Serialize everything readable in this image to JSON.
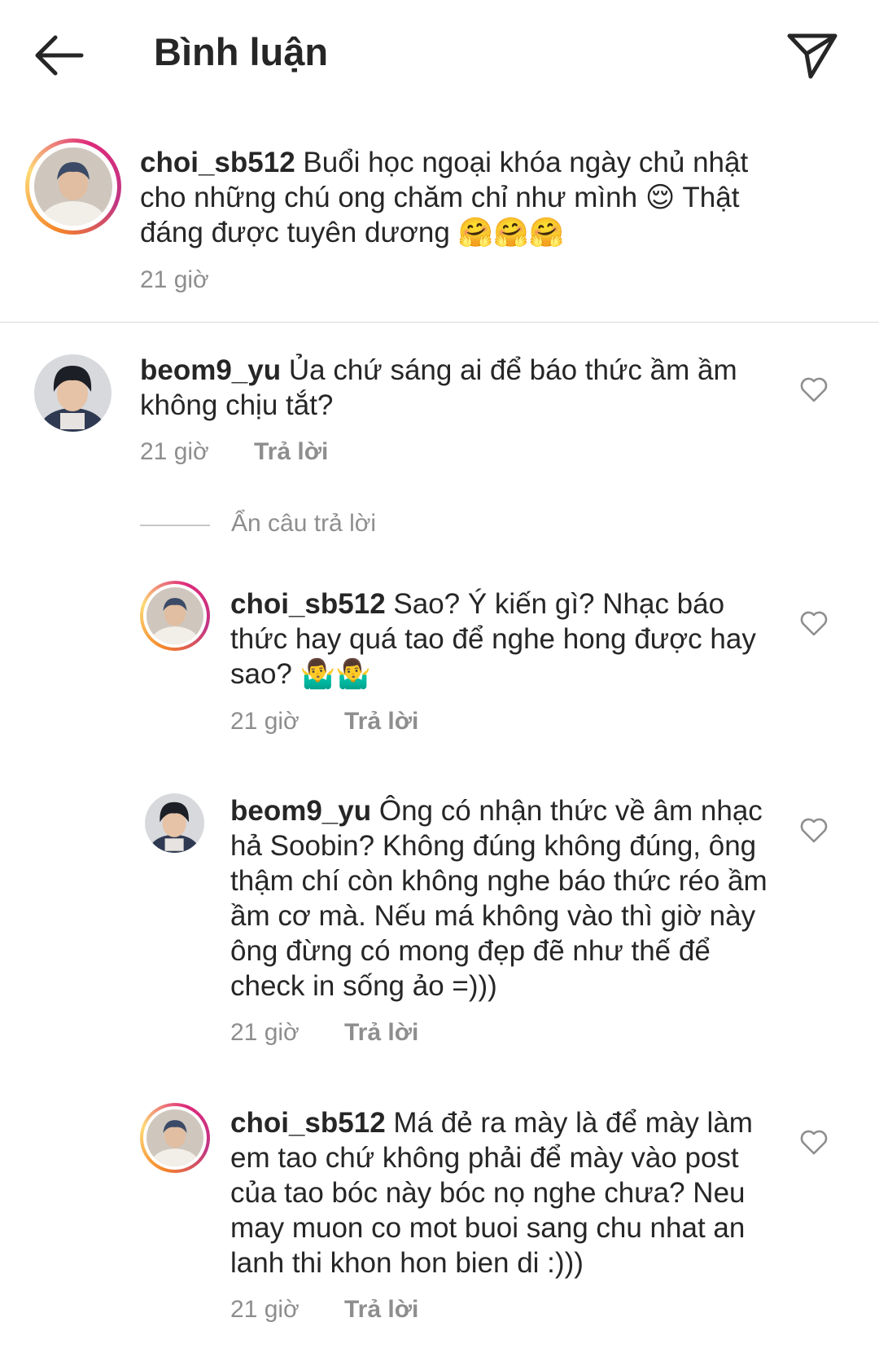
{
  "header": {
    "title": "Bình luận",
    "back_icon": "arrow-left-icon",
    "share_icon": "paper-plane-icon"
  },
  "caption": {
    "username": "choi_sb512",
    "text": "Buổi học ngoại khóa ngày chủ nhật cho những chú ong chăm chỉ như mình 😌 Thật đáng được tuyên dương 🤗🤗🤗",
    "time": "21 giờ"
  },
  "comments": [
    {
      "username": "beom9_yu",
      "text": "Ủa chứ sáng ai để báo thức ầm ầm không chịu tắt?",
      "time": "21 giờ",
      "reply_label": "Trả lời"
    }
  ],
  "hide_replies_label": "Ẩn câu trả lời",
  "replies": [
    {
      "username": "choi_sb512",
      "text": "Sao? Ý kiến gì? Nhạc báo thức hay quá tao để nghe hong được hay sao? 🤷‍♂️🤷‍♂️",
      "time": "21 giờ",
      "reply_label": "Trả lời"
    },
    {
      "username": "beom9_yu",
      "text": "Ông có nhận thức về âm nhạc hả Soobin? Không đúng không đúng, ông thậm chí còn không nghe báo thức réo ầm ầm cơ mà. Nếu má không vào thì giờ này ông đừng có mong đẹp đẽ như thế để check in sống ảo =)))",
      "time": "21 giờ",
      "reply_label": "Trả lời"
    },
    {
      "username": "choi_sb512",
      "text": "Má đẻ ra mày là để mày làm em tao chứ không phải để mày vào post của tao bóc này bóc nọ nghe chưa? Neu may muon co mot buoi sang chu nhat an lanh thi khon hon bien di :)))",
      "time": "21 giờ",
      "reply_label": "Trả lời"
    }
  ],
  "colors": {
    "text": "#262626",
    "muted": "#8e8e8e",
    "divider": "#dbdbdb",
    "story_ring": [
      "#f58529",
      "#dd2a7b",
      "#c13584"
    ]
  }
}
